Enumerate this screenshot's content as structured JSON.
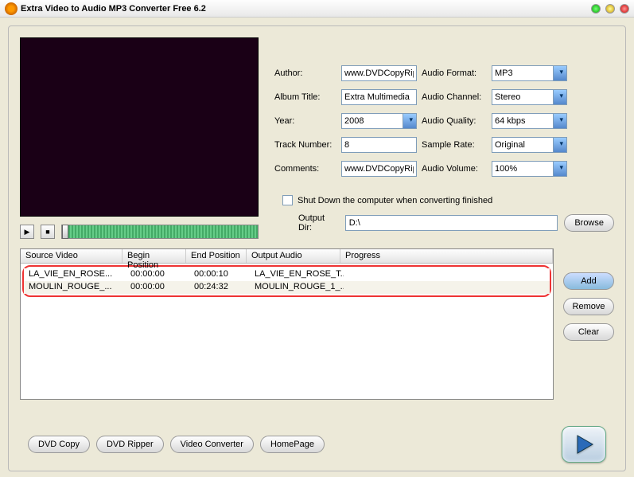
{
  "title": "Extra Video to Audio MP3 Converter Free 6.2",
  "meta": {
    "author_lbl": "Author:",
    "author": "www.DVDCopyRip.co",
    "album_lbl": "Album Title:",
    "album": "Extra Multimedia",
    "year_lbl": "Year:",
    "year": "2008",
    "track_lbl": "Track Number:",
    "track": "8",
    "comments_lbl": "Comments:",
    "comments": "www.DVDCopyRip.co",
    "format_lbl": "Audio Format:",
    "format": "MP3",
    "channel_lbl": "Audio Channel:",
    "channel": "Stereo",
    "quality_lbl": "Audio Quality:",
    "quality": "64 kbps",
    "rate_lbl": "Sample Rate:",
    "rate": "Original",
    "volume_lbl": "Audio Volume:",
    "volume": "100%"
  },
  "shut": "Shut Down the computer when converting finished",
  "outdir_lbl": "Output Dir:",
  "outdir": "D:\\",
  "browse": "Browse",
  "cols": {
    "c0": "Source Video",
    "c1": "Begin Position",
    "c2": "End Position",
    "c3": "Output Audio",
    "c4": "Progress"
  },
  "rows": [
    {
      "src": "LA_VIE_EN_ROSE...",
      "b": "00:00:00",
      "e": "00:00:10",
      "out": "LA_VIE_EN_ROSE_T...",
      "p": ""
    },
    {
      "src": "MOULIN_ROUGE_...",
      "b": "00:00:00",
      "e": "00:24:32",
      "out": "MOULIN_ROUGE_1_...",
      "p": ""
    }
  ],
  "btn": {
    "add": "Add",
    "remove": "Remove",
    "clear": "Clear"
  },
  "foot": {
    "dvd": "DVD Copy",
    "rip": "DVD Ripper",
    "vc": "Video Converter",
    "hp": "HomePage"
  }
}
